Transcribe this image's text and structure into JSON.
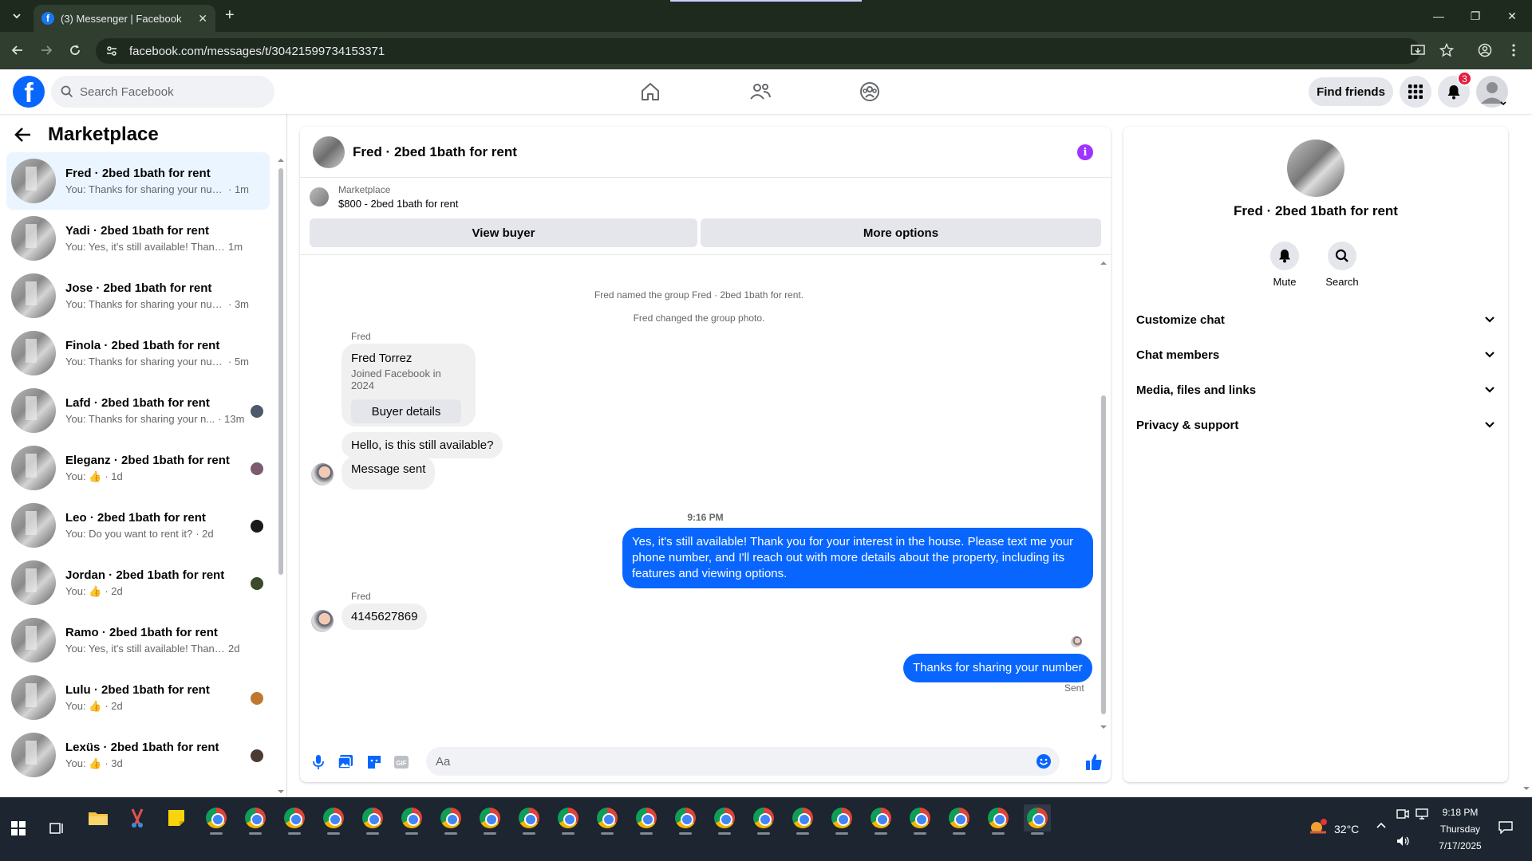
{
  "browser": {
    "tab_title": "(3) Messenger | Facebook",
    "url": "facebook.com/messages/t/30421599734153371"
  },
  "header": {
    "search_placeholder": "Search Facebook",
    "find_friends": "Find friends",
    "notification_count": "3"
  },
  "sidebar": {
    "title": "Marketplace",
    "conversations": [
      {
        "name": "Fred · 2bed 1bath for rent",
        "preview": "You: Thanks for sharing your num...",
        "time": "· 1m"
      },
      {
        "name": "Yadi · 2bed 1bath for rent",
        "preview": "You: Yes, it's still available! Thank y...",
        "time": "1m"
      },
      {
        "name": "Jose · 2bed 1bath for rent",
        "preview": "You: Thanks for sharing your num...",
        "time": "· 3m"
      },
      {
        "name": "Finola · 2bed 1bath for rent",
        "preview": "You: Thanks for sharing your num...",
        "time": "· 5m"
      },
      {
        "name": "Lafd · 2bed 1bath for rent",
        "preview": "You: Thanks for sharing your n...",
        "time": "· 13m"
      },
      {
        "name": "Eleganz · 2bed 1bath for rent",
        "preview": "You: 👍",
        "time": "· 1d"
      },
      {
        "name": "Leo · 2bed 1bath for rent",
        "preview": "You: Do you want to rent it?",
        "time": "· 2d"
      },
      {
        "name": "Jordan · 2bed 1bath for rent",
        "preview": "You: 👍",
        "time": "· 2d"
      },
      {
        "name": "Ramo · 2bed 1bath for rent",
        "preview": "You: Yes, it's still available! Thank yo...",
        "time": "2d"
      },
      {
        "name": "Lulu · 2bed 1bath for rent",
        "preview": "You: 👍",
        "time": "· 2d"
      },
      {
        "name": "Lexüs · 2bed 1bath for rent",
        "preview": "You: 👍",
        "time": "· 3d"
      }
    ]
  },
  "chat": {
    "title": "Fred · 2bed 1bath for rent",
    "marketplace_label": "Marketplace",
    "listing": "$800 - 2bed 1bath for rent",
    "view_buyer": "View buyer",
    "more_options": "More options",
    "system_1": "Fred named the group Fred · 2bed 1bath for rent.",
    "system_2": "Fred changed the group photo.",
    "sender_1": "Fred",
    "card_name": "Fred Torrez",
    "card_sub": "Joined Facebook in 2024",
    "card_button": "Buyer details",
    "msg_in_1": "Hello, is this still available?",
    "msg_in_2": "Message sent",
    "timestamp": "9:16 PM",
    "msg_out_1": "Yes, it's still available! Thank you for your interest in the house. Please text me your phone number, and I'll reach out with more details about the property, including its features and viewing options.",
    "sender_2": "Fred",
    "msg_in_3": "4145627869",
    "msg_out_2": "Thanks for sharing your number",
    "status": "Sent",
    "composer_placeholder": "Aa"
  },
  "details": {
    "name": "Fred · 2bed 1bath for rent",
    "mute": "Mute",
    "search": "Search",
    "sections": [
      "Customize chat",
      "Chat members",
      "Media, files and links",
      "Privacy & support"
    ]
  },
  "taskbar": {
    "temperature": "32°C",
    "time": "9:18 PM",
    "day": "Thursday",
    "date": "7/17/2025"
  }
}
